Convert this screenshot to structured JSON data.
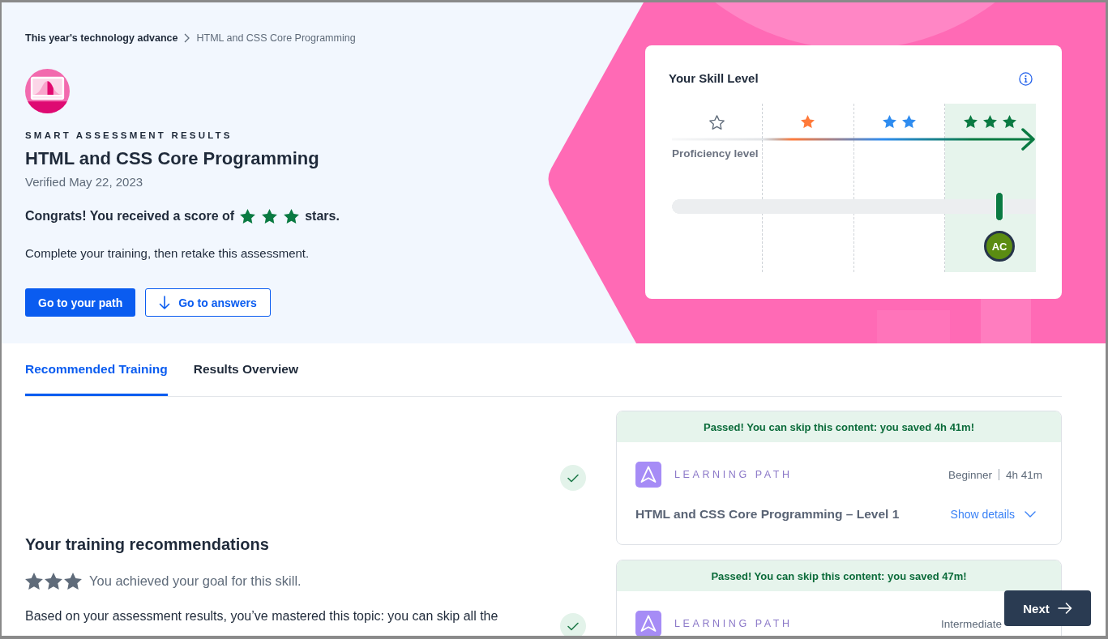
{
  "breadcrumb": [
    {
      "label": "This year's technology advance",
      "current": false
    },
    {
      "label": "HTML and CSS Core Programming",
      "current": true
    }
  ],
  "header": {
    "eyebrow": "SMART ASSESSMENT RESULTS",
    "title": "HTML and CSS Core Programming",
    "verified": "Verified May 22, 2023",
    "score": {
      "before": "Congrats! You received a score of",
      "stars": 3,
      "after": "stars."
    },
    "instruction": "Complete your training, then retake this assessment.",
    "buttons": [
      {
        "label": "Go to your path",
        "kind": "primary"
      },
      {
        "label": "Go to answers",
        "kind": "outline"
      }
    ]
  },
  "skill_card": {
    "title": "Your Skill Level",
    "axis_label": "Proficiency level",
    "levels": [
      {
        "star_icons": [
          {
            "filled": false
          }
        ],
        "color": "#5f6b7a",
        "selected": false
      },
      {
        "star_icons": [
          {
            "filled": true
          }
        ],
        "color": "#ff7a3a",
        "selected": false
      },
      {
        "star_icons": [
          {
            "filled": true
          },
          {
            "filled": true
          }
        ],
        "color": "#2e8cf0",
        "selected": false
      },
      {
        "star_icons": [
          {
            "filled": true
          },
          {
            "filled": true
          },
          {
            "filled": true
          }
        ],
        "color": "#0a7a42",
        "selected": true
      }
    ],
    "level": 0.9,
    "avatar": "AC"
  },
  "tabs": [
    {
      "label": "Recommended Training",
      "selected": true
    },
    {
      "label": "Results Overview",
      "selected": false
    }
  ],
  "training": {
    "heading": "Your training recommendations",
    "goal": {
      "stars": 3,
      "text": "You achieved your goal for this skill."
    },
    "summary": "Based on your assessment results, you’ve mastered this topic: you can skip all the"
  },
  "paths": [
    {
      "completed": true,
      "banner": "Passed! You can skip this content: you saved 4h 41m!",
      "type_label": "LEARNING PATH",
      "difficulty": "Beginner",
      "duration": "4h 41m",
      "title": "HTML and CSS Core Programming – Level 1",
      "details_link": "Show details"
    },
    {
      "completed": true,
      "banner": "Passed! You can skip this content: you saved 47m!",
      "type_label": "LEARNING PATH",
      "difficulty": "Intermediate"
    }
  ],
  "next_button": {
    "label": "Next"
  }
}
